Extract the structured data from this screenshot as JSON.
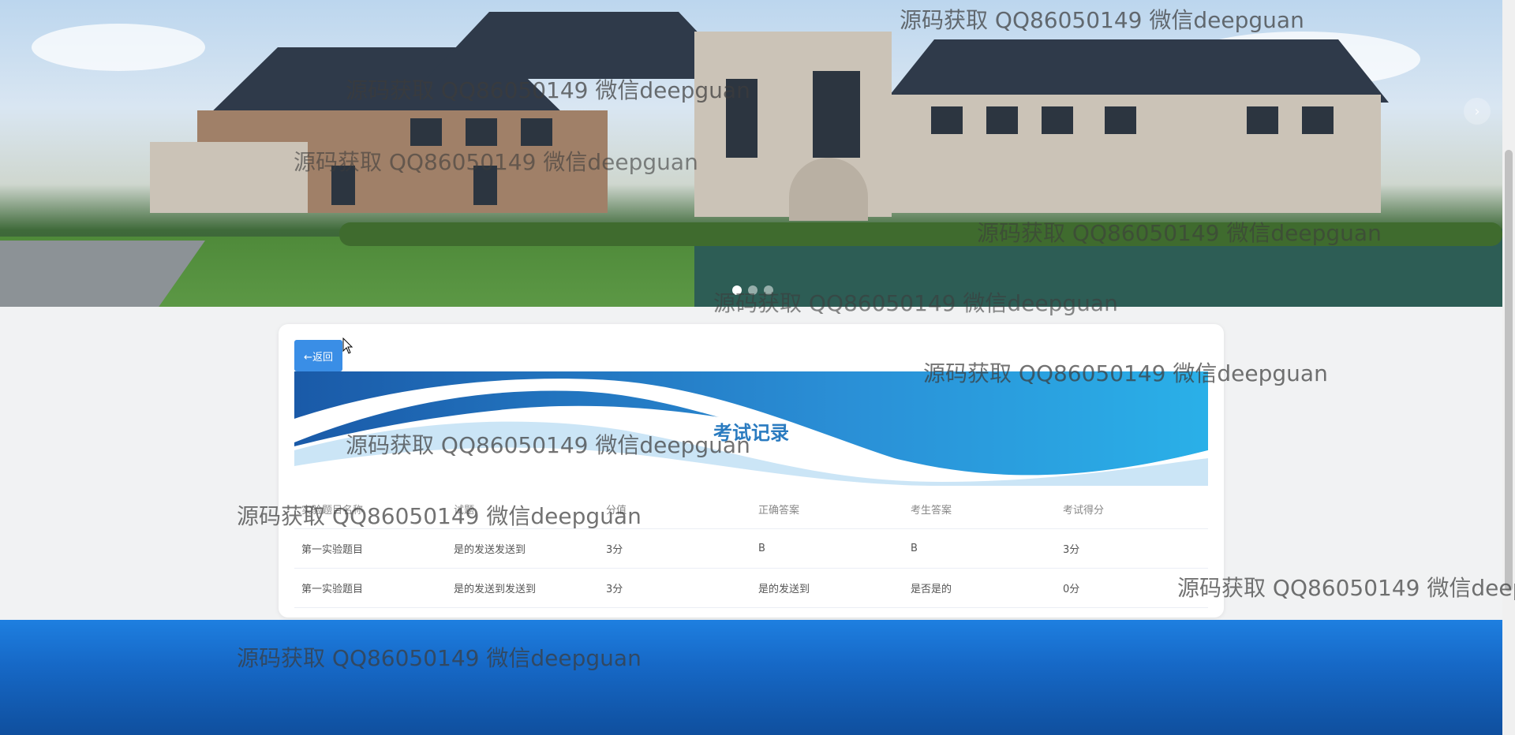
{
  "banner": {
    "dots": [
      true,
      false,
      false
    ],
    "next_icon": "chevron-right-icon"
  },
  "back_button": {
    "label": "←返回"
  },
  "page_title": "考试记录",
  "table": {
    "headers": [
      "实验题目名称",
      "试题",
      "分值",
      "正确答案",
      "考生答案",
      "考试得分"
    ],
    "rows": [
      [
        "第一实验题目",
        "是的发送发送到",
        "3分",
        "B",
        "B",
        "3分"
      ],
      [
        "第一实验题目",
        "是的发送到发送到",
        "3分",
        "是的发送到",
        "是否是的",
        "0分"
      ]
    ]
  },
  "watermark_text": "源码获取 QQ86050149 微信deepguan",
  "colors": {
    "accent": "#3a8ee6",
    "title": "#2a7bc0",
    "footer": "#1668c6"
  }
}
